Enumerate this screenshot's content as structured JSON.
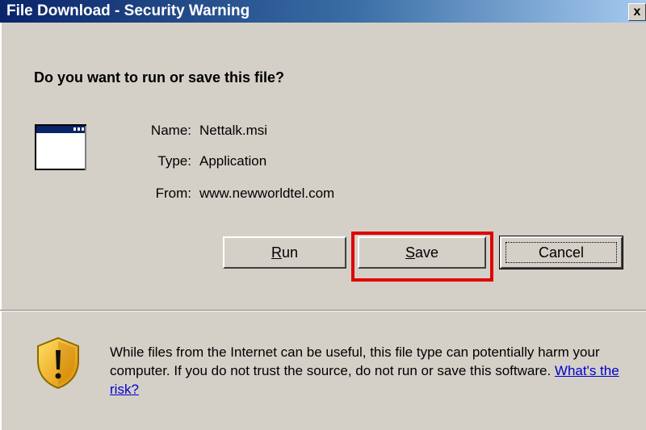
{
  "window": {
    "title": "File Download - Security Warning",
    "close_label": "x"
  },
  "prompt": {
    "question": "Do you want to run or save this file?"
  },
  "file_info": {
    "name_label": "Name:",
    "name_value": "Nettalk.msi",
    "type_label": "Type:",
    "type_value": "Application",
    "from_label": "From:",
    "from_value": "www.newworldtel.com"
  },
  "buttons": {
    "run": {
      "mnemonic": "R",
      "rest": "un"
    },
    "save": {
      "mnemonic": "S",
      "rest": "ave"
    },
    "cancel": "Cancel"
  },
  "warning": {
    "text": "While files from the Internet can be useful, this file type can potentially harm your computer. If you do not trust the source, do not run or save this software. ",
    "link": "What's the risk?"
  },
  "icons": {
    "file": "application-window-icon",
    "shield": "security-shield-icon"
  },
  "colors": {
    "dialog_bg": "#d4d0c8",
    "titlebar_start": "#0a246a",
    "titlebar_end": "#a6caf0",
    "highlight": "#e00000",
    "link": "#0000cc"
  }
}
